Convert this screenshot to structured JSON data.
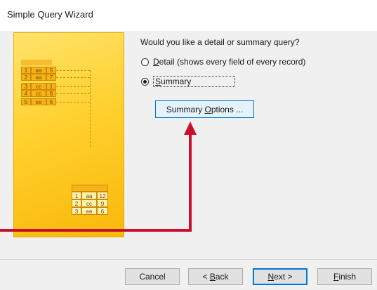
{
  "window": {
    "title": "Simple Query Wizard"
  },
  "illustration": {
    "source_rows": [
      [
        "1",
        "aa",
        "5"
      ],
      [
        "2",
        "aa",
        "7"
      ],
      [
        "3",
        "cc",
        "1"
      ],
      [
        "4",
        "cc",
        "8"
      ],
      [
        "5",
        "ee",
        "6"
      ]
    ],
    "result_rows": [
      [
        "1",
        "aa",
        "12"
      ],
      [
        "2",
        "cc",
        "9"
      ],
      [
        "3",
        "ee",
        "6"
      ]
    ]
  },
  "query": {
    "question": "Would you like a detail or summary query?",
    "detail_accel": "D",
    "detail_rest": "etail (shows every field of every record)",
    "summary_accel": "S",
    "summary_rest": "ummary",
    "selected": "Summary",
    "summary_options_pre": "Summary ",
    "summary_options_accel": "O",
    "summary_options_post": "ptions ..."
  },
  "footer": {
    "cancel": "Cancel",
    "back_pre": "< ",
    "back_accel": "B",
    "back_post": "ack",
    "next_accel": "N",
    "next_post": "ext >",
    "finish_accel": "F",
    "finish_post": "inish"
  },
  "annotation": {
    "arrow_color": "#c8102e"
  }
}
